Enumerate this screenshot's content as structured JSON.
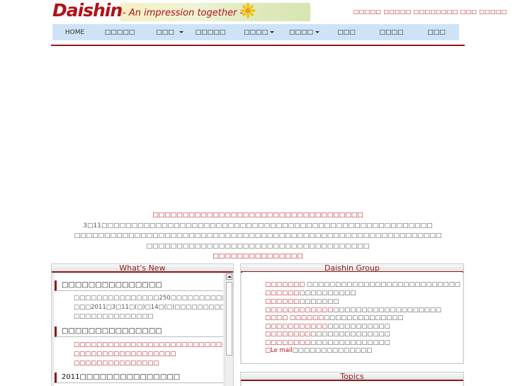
{
  "header": {
    "brand": "Daishin",
    "tagline": "- An impression together -",
    "toplinks": "□□□□□ □□□□□ □□□□□□□□ □□□ □□□□□"
  },
  "nav": {
    "items": [
      {
        "label": "HOME",
        "dropdown": false
      },
      {
        "label": "□□□□□",
        "dropdown": false
      },
      {
        "label": "□□□",
        "dropdown": true
      },
      {
        "label": "□□□□□",
        "dropdown": false
      },
      {
        "label": "□□□□",
        "dropdown": true
      },
      {
        "label": "□□□□",
        "dropdown": true
      },
      {
        "label": "□□□",
        "dropdown": false
      },
      {
        "label": "□□□□",
        "dropdown": false
      },
      {
        "label": "□□□",
        "dropdown": false
      }
    ]
  },
  "notice": {
    "line1": "□□□□□□□□□□□□□□□□□□□□□□□□□□□□□□□□□□□",
    "line2": "3□11□□□□□□□□□□□□□□□□□□□□□□□□□□□□□□□□□□□□□□□□□□□□□□□□□□□□□□□",
    "line3": "□□□□□□□□□□□□□□□□□□□□□□□□□□□□□□□□□□□□□□□□□□□□□□□□□□□□□□□□□□□□□",
    "line4": "□□□□□□□□□□□□□□□□□□□□□□□□□□□□□□□□□□□□□",
    "line5": "□□□□□□□□□□□□□□□"
  },
  "news": {
    "heading": "What's New",
    "items": [
      {
        "title": "□□□□□□□□□□□□□□□",
        "text": [
          "□□□□□□□□□□□□□□□250□□□□□□□□□□□□□□□□□□□□□□□□□",
          "□□□2011□3□11□(□)□14□(□)□□□□□□□□□□□□□□□□□□□",
          "□□□□□□□□□□□□□□"
        ],
        "style": "gray"
      },
      {
        "title": "□□□□□□□□□□□□□□□",
        "text": [
          "□□□□□□□□□□□□□□□□□□□□□□□□□□□□□□□□□□□□□□□□□□□□□",
          "□□□□□□□□□□□□□□□□□□",
          "□□□□□□□□□□□□□□□"
        ],
        "style": "red"
      },
      {
        "title": "2011□□□□□□□□□□□□□□□",
        "text": [],
        "style": "gray"
      }
    ]
  },
  "group": {
    "heading": "Daishin Group",
    "rows": [
      {
        "link": "□□□□□□□",
        "rest": " □□□□□□□□□□□□□□□□□□□□□□□□□□□"
      },
      {
        "link": "□□□□□□",
        "rest": "□□□□□□□□□□"
      },
      {
        "link": "□□□□□□",
        "rest": "□□□□□□□"
      },
      {
        "link": "□□□□□□□□□□□□",
        "rest": "□□□□□□□□□□□□□□□□□□□"
      },
      {
        "link": "□□□□ □□□□□□",
        "rest": "□□□□□□□□□□□□□□"
      },
      {
        "link": "□□□□□□□□□□□",
        "rest": "□□□□□□□□□□□"
      },
      {
        "link": "□□□□□□□□",
        "rest": "□□□□□□□□□□□□□□"
      },
      {
        "link": "□□□□□□□□",
        "rest": "□□□□□□□□□□□□□□"
      },
      {
        "link": "□Le mail",
        "rest": "□□□□□□□□□□□□□□"
      }
    ]
  },
  "topics": {
    "heading": "Topics"
  },
  "colors": {
    "accent": "#b01219",
    "nav_bg": "#cfe3f7",
    "rule": "#8a1a1a"
  }
}
